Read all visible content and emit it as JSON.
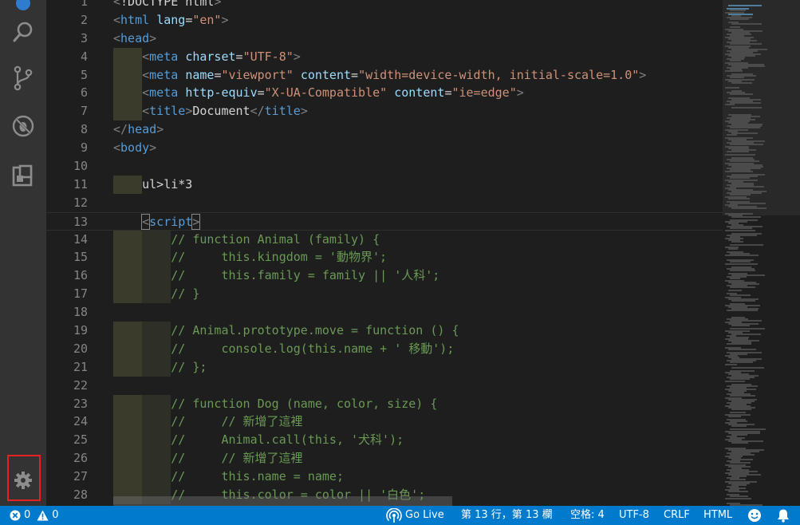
{
  "editor": {
    "lines": [
      {
        "n": "1",
        "indent": 0,
        "parts": [
          [
            "br",
            "<"
          ],
          [
            "txt",
            "!DOCTYPE html"
          ],
          [
            "br",
            ">"
          ]
        ]
      },
      {
        "n": "2",
        "indent": 0,
        "parts": [
          [
            "br",
            "<"
          ],
          [
            "tag",
            "html "
          ],
          [
            "attr",
            "lang"
          ],
          [
            "txt",
            "="
          ],
          [
            "str",
            "\"en\""
          ],
          [
            "br",
            ">"
          ]
        ]
      },
      {
        "n": "3",
        "indent": 0,
        "parts": [
          [
            "br",
            "<"
          ],
          [
            "tag",
            "head"
          ],
          [
            "br",
            ">"
          ]
        ]
      },
      {
        "n": "4",
        "indent": 1,
        "parts": [
          [
            "txt",
            "    "
          ],
          [
            "br",
            "<"
          ],
          [
            "tag",
            "meta "
          ],
          [
            "attr",
            "charset"
          ],
          [
            "txt",
            "="
          ],
          [
            "str",
            "\"UTF-8\""
          ],
          [
            "br",
            ">"
          ]
        ]
      },
      {
        "n": "5",
        "indent": 1,
        "parts": [
          [
            "txt",
            "    "
          ],
          [
            "br",
            "<"
          ],
          [
            "tag",
            "meta "
          ],
          [
            "attr",
            "name"
          ],
          [
            "txt",
            "="
          ],
          [
            "str",
            "\"viewport\" "
          ],
          [
            "attr",
            "content"
          ],
          [
            "txt",
            "="
          ],
          [
            "str",
            "\"width=device-width, initial-scale=1.0\""
          ],
          [
            "br",
            ">"
          ]
        ]
      },
      {
        "n": "6",
        "indent": 1,
        "parts": [
          [
            "txt",
            "    "
          ],
          [
            "br",
            "<"
          ],
          [
            "tag",
            "meta "
          ],
          [
            "attr",
            "http-equiv"
          ],
          [
            "txt",
            "="
          ],
          [
            "str",
            "\"X-UA-Compatible\" "
          ],
          [
            "attr",
            "content"
          ],
          [
            "txt",
            "="
          ],
          [
            "str",
            "\"ie=edge\""
          ],
          [
            "br",
            ">"
          ]
        ]
      },
      {
        "n": "7",
        "indent": 1,
        "parts": [
          [
            "txt",
            "    "
          ],
          [
            "br",
            "<"
          ],
          [
            "tag",
            "title"
          ],
          [
            "br",
            ">"
          ],
          [
            "txt",
            "Document"
          ],
          [
            "br",
            "</"
          ],
          [
            "tag",
            "title"
          ],
          [
            "br",
            ">"
          ]
        ]
      },
      {
        "n": "8",
        "indent": 0,
        "parts": [
          [
            "br",
            "</"
          ],
          [
            "tag",
            "head"
          ],
          [
            "br",
            ">"
          ]
        ]
      },
      {
        "n": "9",
        "indent": 0,
        "parts": [
          [
            "br",
            "<"
          ],
          [
            "tag",
            "body"
          ],
          [
            "br",
            ">"
          ]
        ]
      },
      {
        "n": "10",
        "indent": 0,
        "parts": []
      },
      {
        "n": "11",
        "indent": 1,
        "parts": [
          [
            "txt",
            "    ul>li*3"
          ]
        ]
      },
      {
        "n": "12",
        "indent": 0,
        "parts": []
      },
      {
        "n": "13",
        "indent": 0,
        "current": true,
        "parts": [
          [
            "txt",
            "    "
          ],
          [
            "br",
            "<"
          ],
          [
            "tag",
            "script"
          ],
          [
            "br",
            ">"
          ]
        ]
      },
      {
        "n": "14",
        "indent": 2,
        "parts": [
          [
            "cmt",
            "        // function Animal (family) {"
          ]
        ]
      },
      {
        "n": "15",
        "indent": 2,
        "parts": [
          [
            "cmt",
            "        //     this.kingdom = '動物界';"
          ]
        ]
      },
      {
        "n": "16",
        "indent": 2,
        "parts": [
          [
            "cmt",
            "        //     this.family = family || '人科';"
          ]
        ]
      },
      {
        "n": "17",
        "indent": 2,
        "parts": [
          [
            "cmt",
            "        // }"
          ]
        ]
      },
      {
        "n": "18",
        "indent": 0,
        "parts": []
      },
      {
        "n": "19",
        "indent": 2,
        "parts": [
          [
            "cmt",
            "        // Animal.prototype.move = function () {"
          ]
        ]
      },
      {
        "n": "20",
        "indent": 2,
        "parts": [
          [
            "cmt",
            "        //     console.log(this.name + ' 移動');"
          ]
        ]
      },
      {
        "n": "21",
        "indent": 2,
        "parts": [
          [
            "cmt",
            "        // };"
          ]
        ]
      },
      {
        "n": "22",
        "indent": 0,
        "parts": []
      },
      {
        "n": "23",
        "indent": 2,
        "parts": [
          [
            "cmt",
            "        // function Dog (name, color, size) {"
          ]
        ]
      },
      {
        "n": "24",
        "indent": 2,
        "parts": [
          [
            "cmt",
            "        //     // 新增了這裡"
          ]
        ]
      },
      {
        "n": "25",
        "indent": 2,
        "parts": [
          [
            "cmt",
            "        //     Animal.call(this, '犬科');"
          ]
        ]
      },
      {
        "n": "26",
        "indent": 2,
        "parts": [
          [
            "cmt",
            "        //     // 新增了這裡"
          ]
        ]
      },
      {
        "n": "27",
        "indent": 2,
        "parts": [
          [
            "cmt",
            "        //     this.name = name;"
          ]
        ]
      },
      {
        "n": "28",
        "indent": 2,
        "parts": [
          [
            "cmt",
            "        //     this.color = color || '白色';"
          ]
        ]
      }
    ]
  },
  "status": {
    "errors": "0",
    "warnings": "0",
    "go_live": "Go Live",
    "position": "第 13 行，第 13 欄",
    "spaces": "空格: 4",
    "encoding": "UTF-8",
    "eol": "CRLF",
    "language": "HTML"
  },
  "colors": {
    "status_bar": "#007acc",
    "activity_bar": "#333333",
    "editor_bg": "#1e1e1e",
    "highlight_border": "#e52222"
  },
  "icons": {
    "activity": [
      "search-icon",
      "source-control-icon",
      "debug-icon",
      "extensions-icon",
      "gear-icon"
    ],
    "status": [
      "error-icon",
      "warning-icon",
      "broadcast-icon",
      "smiley-icon",
      "bell-icon"
    ]
  }
}
